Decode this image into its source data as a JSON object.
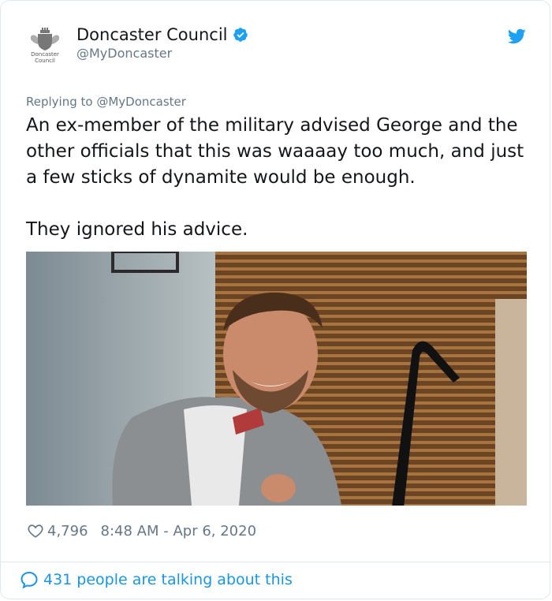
{
  "account": {
    "name": "Doncaster Council",
    "handle": "@MyDoncaster",
    "logo_text": "Doncaster Council"
  },
  "reply": {
    "prefix": "Replying to ",
    "target": "@MyDoncaster"
  },
  "tweet": {
    "text": "An ex-member of the military advised George and the other officials that this was waaaay too much, and just a few sticks of dynamite would be enough.\n\nThey ignored his advice."
  },
  "meta": {
    "likes": "4,796",
    "time": "8:48 AM - Apr 6, 2020"
  },
  "footer": {
    "talking": "431 people are talking about this"
  },
  "colors": {
    "accent": "#1da1f2",
    "link": "#1b95e0",
    "secondary_text": "#657786",
    "border": "#e1e8ed"
  },
  "icons": [
    "council-crest-icon",
    "verified-badge-icon",
    "twitter-bird-icon",
    "heart-icon",
    "speech-bubble-icon"
  ]
}
